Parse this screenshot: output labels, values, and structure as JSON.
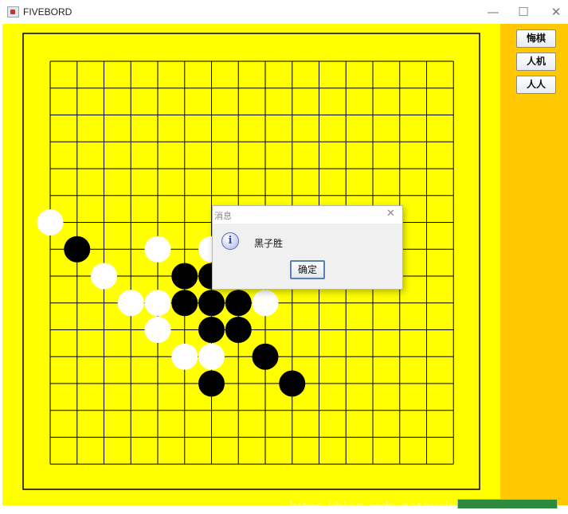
{
  "window": {
    "title": "FIVEBORD",
    "minimize_glyph": "—",
    "maximize_glyph": "☐",
    "close_glyph": "✕"
  },
  "colors": {
    "board_background": "#ffff00",
    "side_panel": "#ffc800",
    "grid_line": "#000000",
    "black_stone": "#000000",
    "white_stone": "#ffffff"
  },
  "side_buttons": [
    {
      "label": "悔棋"
    },
    {
      "label": "人机"
    },
    {
      "label": "人人"
    }
  ],
  "board": {
    "grid_size": 16,
    "stones": [
      {
        "color": "white",
        "col": 0,
        "row": 6
      },
      {
        "color": "black",
        "col": 1,
        "row": 7
      },
      {
        "color": "white",
        "col": 2,
        "row": 8
      },
      {
        "color": "white",
        "col": 3,
        "row": 9
      },
      {
        "color": "white",
        "col": 4,
        "row": 7
      },
      {
        "color": "white",
        "col": 4,
        "row": 9
      },
      {
        "color": "white",
        "col": 4,
        "row": 10
      },
      {
        "color": "black",
        "col": 5,
        "row": 8
      },
      {
        "color": "black",
        "col": 5,
        "row": 9
      },
      {
        "color": "white",
        "col": 5,
        "row": 11
      },
      {
        "color": "white",
        "col": 6,
        "row": 7
      },
      {
        "color": "black",
        "col": 6,
        "row": 8
      },
      {
        "color": "black",
        "col": 6,
        "row": 9
      },
      {
        "color": "black",
        "col": 6,
        "row": 10
      },
      {
        "color": "white",
        "col": 6,
        "row": 11
      },
      {
        "color": "black",
        "col": 6,
        "row": 12
      },
      {
        "color": "black",
        "col": 7,
        "row": 9
      },
      {
        "color": "black",
        "col": 7,
        "row": 10
      },
      {
        "color": "white",
        "col": 8,
        "row": 9
      },
      {
        "color": "black",
        "col": 8,
        "row": 11
      },
      {
        "color": "black",
        "col": 9,
        "row": 12
      }
    ]
  },
  "dialog": {
    "title": "消息",
    "close_glyph": "✕",
    "icon_glyph": "i",
    "message": "黑子胜",
    "ok_label": "确定"
  },
  "watermark": "https://blog.csdn.net/weixin_4037177"
}
